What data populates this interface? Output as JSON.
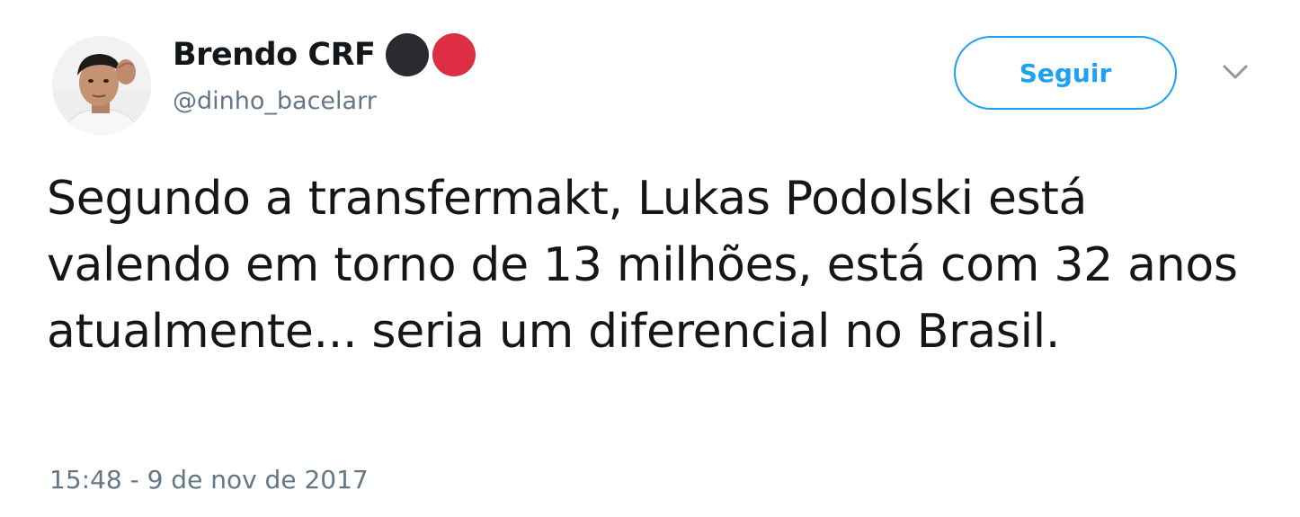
{
  "author": {
    "display_name": "Brendo CRF",
    "handle": "@dinho_bacelarr",
    "emoji_circles": [
      {
        "icon": "black-circle-emoji",
        "color": "#2a2b30"
      },
      {
        "icon": "red-circle-emoji",
        "color": "#dd2e44"
      }
    ]
  },
  "actions": {
    "follow_label": "Seguir",
    "more_icon": "chevron-down-icon"
  },
  "tweet": {
    "text": "Segundo a transfermakt, Lukas Podolski está valendo em torno de 13 milhões, está com 32 anos atualmente... seria um diferencial no Brasil.",
    "timestamp": "15:48 - 9 de nov de 2017"
  },
  "colors": {
    "accent": "#1da1f2",
    "text_primary": "#14171a",
    "text_secondary": "#657786"
  }
}
